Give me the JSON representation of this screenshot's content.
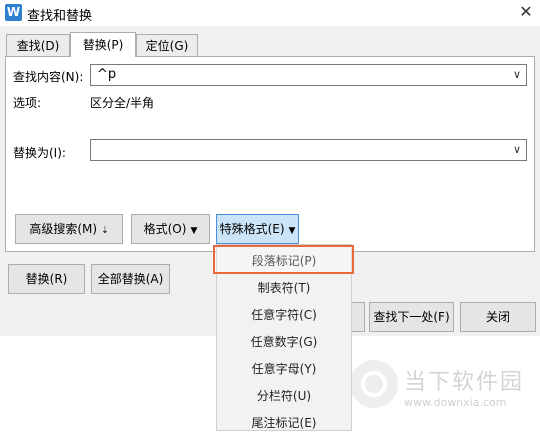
{
  "window": {
    "title": "查找和替换",
    "app_icon_letter": "W",
    "close_glyph": "✕"
  },
  "tabs": [
    {
      "label": "查找(D)",
      "active": false
    },
    {
      "label": "替换(P)",
      "active": true
    },
    {
      "label": "定位(G)",
      "active": false
    }
  ],
  "find": {
    "label": "查找内容(N):",
    "value": "^p",
    "options_label": "选项:",
    "options_value": "区分全/半角"
  },
  "replace": {
    "label": "替换为(I):",
    "value": ""
  },
  "buttons": {
    "advanced_search": "高级搜索(M)",
    "advanced_search_caret": "⇣",
    "format": "格式(O)",
    "special_format": "特殊格式(E)",
    "replace": "替换(R)",
    "replace_all": "全部替换(A)",
    "find_prev_partial": "",
    "find_next": "查找下一处(F)",
    "close": "关闭",
    "caret": "▼"
  },
  "special_format_menu": {
    "items": [
      "段落标记(P)",
      "制表符(T)",
      "任意字符(C)",
      "任意数字(G)",
      "任意字母(Y)",
      "分栏符(U)",
      "尾注标记(E)"
    ],
    "highlighted_index": 0
  },
  "colors": {
    "highlight_border": "#e86a3a",
    "active_button_bg": "#cce4f7",
    "app_icon_bg": "#2f80d1"
  },
  "watermark": {
    "text": "当下软件园",
    "url": "www.downxia.com"
  }
}
